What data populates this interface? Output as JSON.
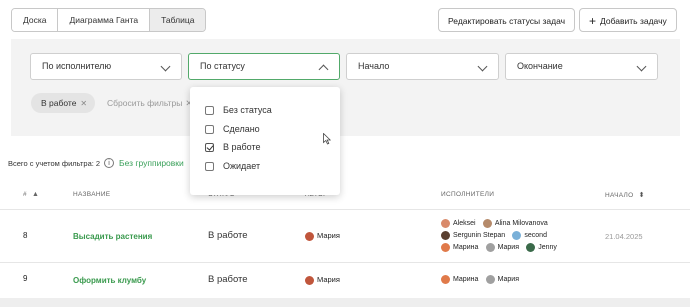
{
  "view_tabs": [
    {
      "label": "Доска"
    },
    {
      "label": "Диаграмма Ганта"
    },
    {
      "label": "Таблица",
      "active": true
    }
  ],
  "toolbar": {
    "edit_statuses_label": "Редактировать статусы задач",
    "add_task_label": "Добавить задачу",
    "add_icon": "plus-icon"
  },
  "filters": {
    "assignee": "По исполнителю",
    "status": "По статусу",
    "start": "Начало",
    "end": "Окончание"
  },
  "active_filter_chip": "В работе",
  "reset_filters_label": "Сбросить фильтры",
  "status_dropdown": {
    "options": [
      {
        "label": "Без статуса",
        "checked": false
      },
      {
        "label": "Сделано",
        "checked": false
      },
      {
        "label": "В работе",
        "checked": true
      },
      {
        "label": "Ожидает",
        "checked": false
      }
    ]
  },
  "summary": {
    "total_label": "Всего с учетом фильтра: 2",
    "grouping_label": "Без группировки"
  },
  "table": {
    "headers": {
      "num": "#",
      "title": "НАЗВАНИЕ",
      "status": "СТАТУС",
      "author": "АВТОР",
      "assignees": "ИСПОЛНИТЕЛИ",
      "start": "НАЧАЛО"
    },
    "rows": [
      {
        "num": "8",
        "title": "Высадить растения",
        "status": "В работе",
        "author": "Мария",
        "assignees": [
          "Aleksei",
          "Alina Milovanova",
          "Sergunin Stepan",
          "second",
          "Марина",
          "Мария",
          "Jenny"
        ],
        "start": "21.04.2025"
      },
      {
        "num": "9",
        "title": "Оформить клумбу",
        "status": "В работе",
        "author": "Мария",
        "assignees": [
          "Марина",
          "Мария"
        ],
        "start": ""
      }
    ]
  },
  "colors": {
    "accent": "#3a9a4e",
    "panel_bg": "#f3f3f3"
  }
}
